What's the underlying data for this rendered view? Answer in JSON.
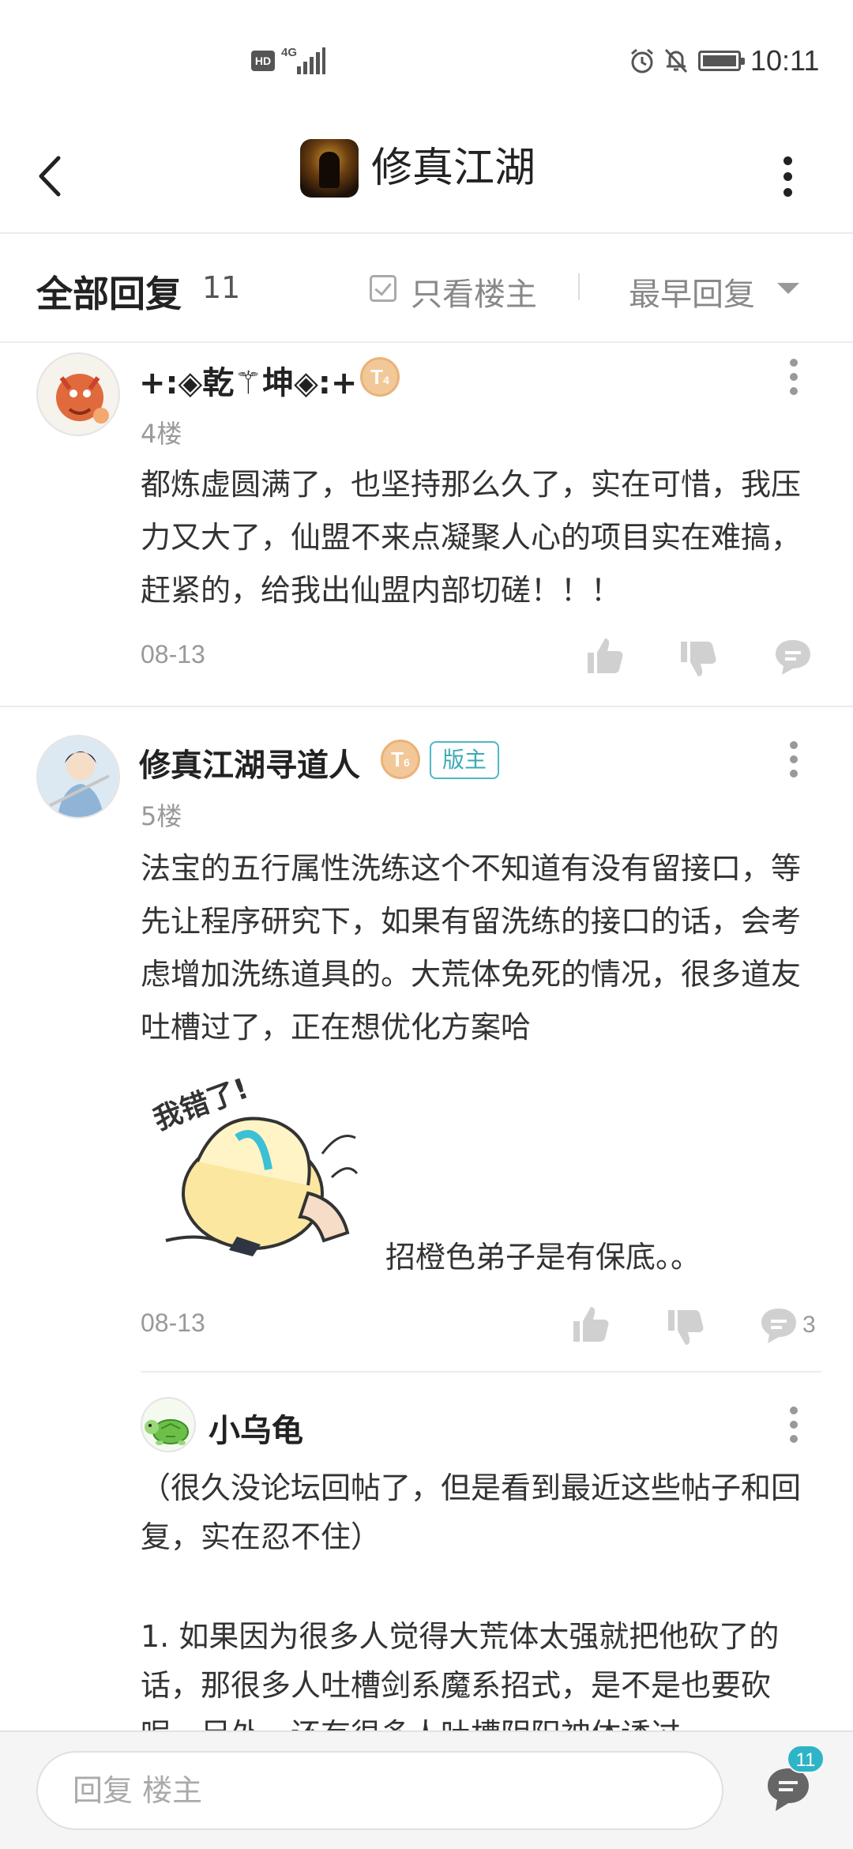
{
  "status_bar": {
    "network_hd": "HD",
    "network_type": "4G",
    "time": "10:11"
  },
  "header": {
    "title": "修真江湖",
    "icons": [
      "back-arrow-icon",
      "app-icon",
      "more-vertical-icon"
    ]
  },
  "filter_bar": {
    "title": "全部回复",
    "count": "11",
    "only_author_label": "只看楼主",
    "sort_label": "最早回复"
  },
  "posts": [
    {
      "username": "+:◈乾⚚坤◈:+",
      "level": "T",
      "level_num": "4",
      "floor": "4楼",
      "text": "都炼虚圆满了，也坚持那么久了，实在可惜，我压力又大了，仙盟不来点凝聚人心的项目实在难搞，赶紧的，给我出仙盟内部切磋！！！",
      "date": "08-13"
    },
    {
      "username": "修真江湖寻道人",
      "level": "T",
      "level_num": "6",
      "role_badge": "版主",
      "floor": "5楼",
      "text": "法宝的五行属性洗练这个不知道有没有留接口，等先让程序研究下，如果有留洗练的接口的话，会考虑增加洗练道具的。大荒体免死的情况，很多道友吐槽过了，正在想优化方案哈",
      "sticker_text": "我错了!",
      "sticker_caption": "招橙色弟子是有保底。。",
      "date": "08-13",
      "reply_count": "3",
      "sub_reply": {
        "username": "小乌龟",
        "text_1": "（很久没论坛回帖了，但是看到最近这些帖子和回复，实在忍不住）",
        "text_2": "1. 如果因为很多人觉得大荒体太强就把他砍了的话，那很多人吐槽剑系魔系招式，是不是也要砍呢，另外，还有很多人吐槽阴阳神体诱过"
      }
    }
  ],
  "bottom_bar": {
    "reply_placeholder": "回复  楼主",
    "comments_badge": "11"
  },
  "colors": {
    "accent": "#2db4c6",
    "moderator_badge": "#3aa9b8",
    "level_badge": "#f3c898"
  }
}
